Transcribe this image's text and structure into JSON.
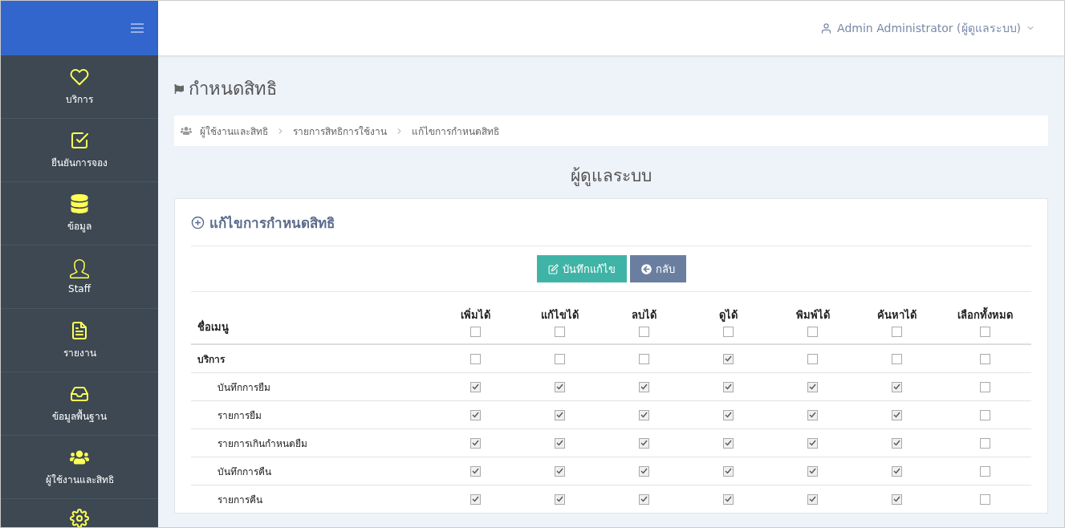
{
  "sidebar": {
    "items": [
      {
        "label": "บริการ"
      },
      {
        "label": "ยืนยันการจอง"
      },
      {
        "label": "ข้อมูล"
      },
      {
        "label": "Staff"
      },
      {
        "label": "รายงาน"
      },
      {
        "label": "ข้อมูลพื้นฐาน"
      },
      {
        "label": "ผู้ใช้งานและสิทธิ"
      }
    ]
  },
  "header": {
    "user": "Admin Administrator (ผู้ดูแลระบบ)"
  },
  "page_title": "กำหนดสิทธิ",
  "breadcrumb": [
    "ผู้ใช้งานและสิทธิ",
    "รายการสิทธิการใช้งาน",
    "แก้ไขการกำหนดสิทธิ"
  ],
  "role_heading": "ผู้ดูแลระบบ",
  "card": {
    "title": "แก้ไขการกำหนดสิทธิ",
    "buttons": [
      {
        "kind": "save",
        "label": "บันทึกแก้ไข"
      },
      {
        "kind": "back",
        "label": "กลับ"
      }
    ],
    "name_column": "ชื่อเมนู",
    "columns": [
      {
        "label": "เพิ่มได้",
        "checked": false
      },
      {
        "label": "แก้ไขได้",
        "checked": false
      },
      {
        "label": "ลบได้",
        "checked": false
      },
      {
        "label": "ดูได้",
        "checked": false
      },
      {
        "label": "พิมพ์ได้",
        "checked": false
      },
      {
        "label": "ค้นหาได้",
        "checked": false
      },
      {
        "label": "เลือกทั้งหมด",
        "checked": false
      }
    ],
    "rows": [
      {
        "name": "บริการ",
        "checks": [
          false,
          false,
          false,
          true,
          false,
          false,
          false
        ],
        "children": [
          {
            "name": "บันทึกการยืม",
            "checks": [
              true,
              true,
              true,
              true,
              true,
              true,
              false
            ]
          },
          {
            "name": "รายการยืม",
            "checks": [
              true,
              true,
              true,
              true,
              true,
              true,
              false
            ]
          },
          {
            "name": "รายการเกินกำหนดยืม",
            "checks": [
              true,
              true,
              true,
              true,
              true,
              true,
              false
            ]
          },
          {
            "name": "บันทึกการคืน",
            "checks": [
              true,
              true,
              true,
              true,
              true,
              true,
              false
            ]
          },
          {
            "name": "รายการคืน",
            "checks": [
              true,
              true,
              true,
              true,
              true,
              true,
              false
            ]
          }
        ]
      }
    ]
  }
}
